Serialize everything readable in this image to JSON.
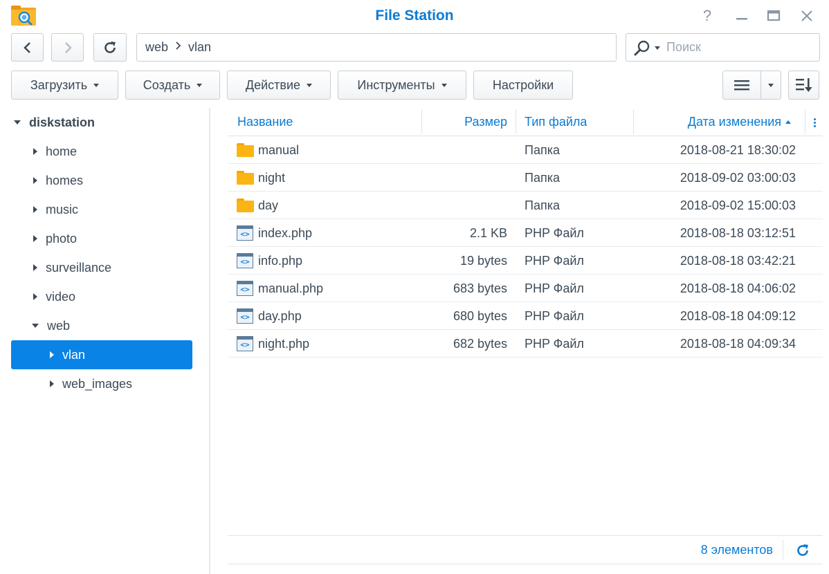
{
  "window": {
    "title": "File Station",
    "help_label": "?",
    "icons": {
      "app": "file-station-icon",
      "help": "help-icon",
      "minimize": "minimize-icon",
      "maximize": "maximize-icon",
      "close": "close-icon"
    }
  },
  "nav": {
    "breadcrumb": [
      "web",
      "vlan"
    ],
    "search_placeholder": "Поиск",
    "icons": {
      "back": "chevron-left-icon",
      "forward": "chevron-right-icon",
      "refresh": "refresh-icon",
      "favorite": "star-icon",
      "search": "search-icon"
    }
  },
  "toolbar": {
    "upload": "Загрузить",
    "create": "Создать",
    "action": "Действие",
    "tools": "Инструменты",
    "settings": "Настройки",
    "icons": {
      "view": "list-view-icon",
      "view_dropdown": "caret-down-icon",
      "sort": "sort-icon"
    }
  },
  "tree": {
    "root": "diskstation",
    "items": [
      "home",
      "homes",
      "music",
      "photo",
      "surveillance",
      "video",
      "web"
    ],
    "web_children": [
      "vlan",
      "web_images"
    ],
    "selected": "vlan"
  },
  "columns": {
    "name": "Название",
    "size": "Размер",
    "type": "Тип файла",
    "modified": "Дата изменения",
    "sort": "ascending"
  },
  "files": [
    {
      "name": "manual",
      "size": "",
      "type": "Папка",
      "modified": "2018-08-21 18:30:02",
      "icon": "folder-icon"
    },
    {
      "name": "night",
      "size": "",
      "type": "Папка",
      "modified": "2018-09-02 03:00:03",
      "icon": "folder-icon"
    },
    {
      "name": "day",
      "size": "",
      "type": "Папка",
      "modified": "2018-09-02 15:00:03",
      "icon": "folder-icon"
    },
    {
      "name": "index.php",
      "size": "2.1 KB",
      "type": "PHP Файл",
      "modified": "2018-08-18 03:12:51",
      "icon": "php-file-icon"
    },
    {
      "name": "info.php",
      "size": "19 bytes",
      "type": "PHP Файл",
      "modified": "2018-08-18 03:42:21",
      "icon": "php-file-icon"
    },
    {
      "name": "manual.php",
      "size": "683 bytes",
      "type": "PHP Файл",
      "modified": "2018-08-18 04:06:02",
      "icon": "php-file-icon"
    },
    {
      "name": "day.php",
      "size": "680 bytes",
      "type": "PHP Файл",
      "modified": "2018-08-18 04:09:12",
      "icon": "php-file-icon"
    },
    {
      "name": "night.php",
      "size": "682 bytes",
      "type": "PHP Файл",
      "modified": "2018-08-18 04:09:34",
      "icon": "php-file-icon"
    }
  ],
  "footer": {
    "count": "8 элементов"
  },
  "colors": {
    "accent": "#0a7bd4",
    "selected": "#0a83e6",
    "folder": "#fbb414",
    "text": "#3c4a57"
  }
}
